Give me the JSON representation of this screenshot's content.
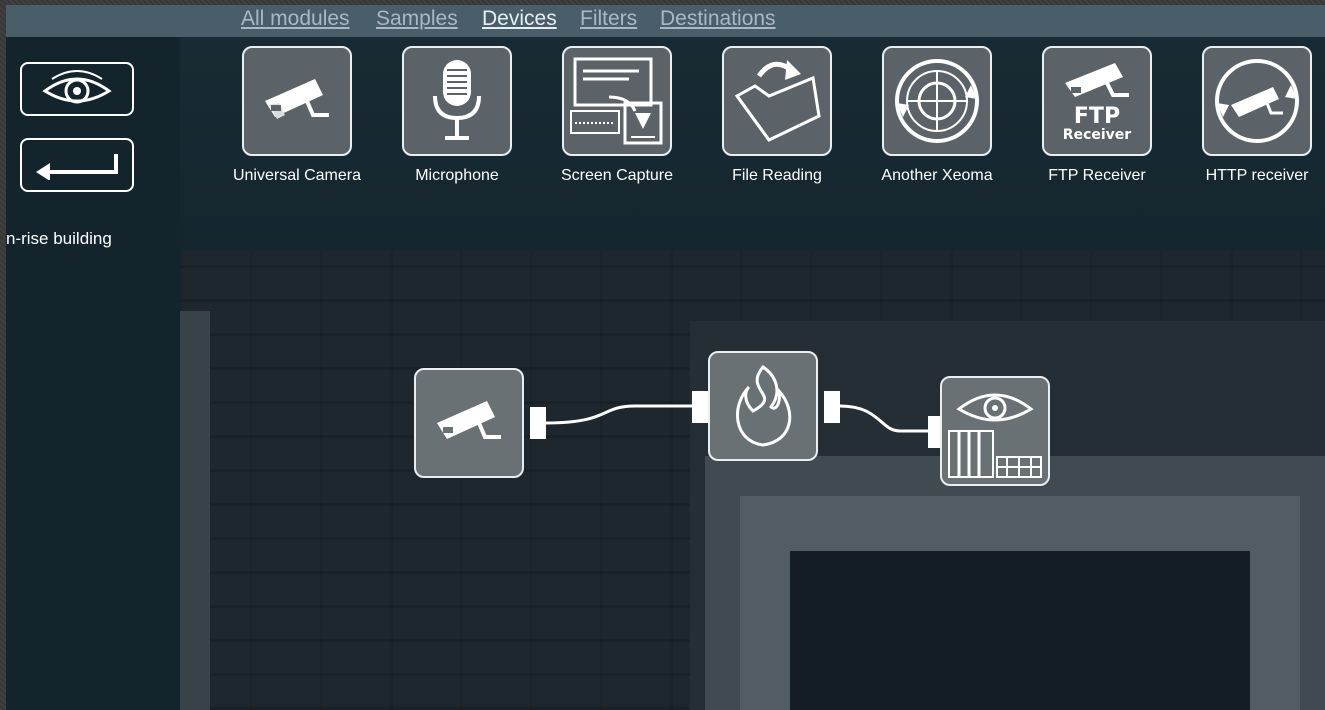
{
  "tabs": [
    {
      "label": "All modules",
      "active": false
    },
    {
      "label": "Samples",
      "active": false
    },
    {
      "label": "Devices",
      "active": true
    },
    {
      "label": "Filters",
      "active": false
    },
    {
      "label": "Destinations",
      "active": false
    }
  ],
  "left_panel": {
    "view_button_icon": "eye-icon",
    "back_button_icon": "back-arrow-icon",
    "scene_label": "n-rise building"
  },
  "devices": [
    {
      "label": "Universal Camera",
      "icon": "camera-icon"
    },
    {
      "label": "Microphone",
      "icon": "microphone-icon"
    },
    {
      "label": "Screen Capture",
      "icon": "screen-capture-icon"
    },
    {
      "label": "File Reading",
      "icon": "folder-icon"
    },
    {
      "label": "Another Xeoma",
      "icon": "xeoma-icon"
    },
    {
      "label": "FTP Receiver",
      "icon": "ftp-receiver-icon",
      "tile_text_top": "FTP",
      "tile_text_bottom": "Receiver"
    },
    {
      "label": "HTTP receiver",
      "icon": "http-receiver-icon"
    }
  ],
  "chain": [
    {
      "module": "camera",
      "icon": "camera-icon"
    },
    {
      "module": "fire-detector",
      "icon": "fire-icon"
    },
    {
      "module": "preview-archive",
      "icon": "preview-archive-icon"
    }
  ],
  "colors": {
    "tabbar_bg": "#4a5e6a",
    "panel_bg": "#13242d",
    "tile_bg": "#5b6368",
    "tile_border": "#e9eef1"
  }
}
